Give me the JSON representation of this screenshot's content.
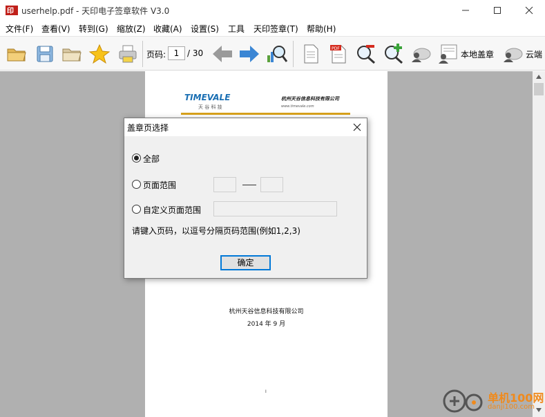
{
  "window": {
    "title": "userhelp.pdf - 天印电子签章软件 V3.0"
  },
  "menu": {
    "items": [
      "文件(F)",
      "查看(V)",
      "转到(G)",
      "缩放(Z)",
      "收藏(A)",
      "设置(S)",
      "工具",
      "天印签章(T)",
      "帮助(H)"
    ]
  },
  "toolbar": {
    "page_label": "页码:",
    "page_current": "1",
    "page_total": "/ 30",
    "local_seal_label": "本地盖章",
    "cloud_seal_label": "云端"
  },
  "document": {
    "logo_text": "TIMEVALE",
    "logo_sub": "天 谷 科 技",
    "company_header": "杭州天谷信息科技有限公司",
    "website": "www.timevale.com",
    "footer_company": "杭州天谷信息科技有限公司",
    "footer_date": "2014 年 9 月",
    "page_number": "I"
  },
  "dialog": {
    "title": "盖章页选择",
    "options": [
      {
        "label": "全部",
        "checked": true
      },
      {
        "label": "页面范围",
        "checked": false
      },
      {
        "label": "自定义页面范围",
        "checked": false
      }
    ],
    "range_from": "",
    "range_to": "",
    "custom_range": "",
    "hint": "请键入页码，以逗号分隔页码范围(例如1,2,3)",
    "ok_label": "确定"
  },
  "watermark": {
    "text1": "单机100网",
    "text2": "danji100.com"
  },
  "colors": {
    "workspace": "#b0b0b0",
    "accent_blue": "#0078d7",
    "logo_blue": "#1a6fb3",
    "logo_gold": "#d8a21c",
    "watermark_orange": "#f08a1c"
  }
}
